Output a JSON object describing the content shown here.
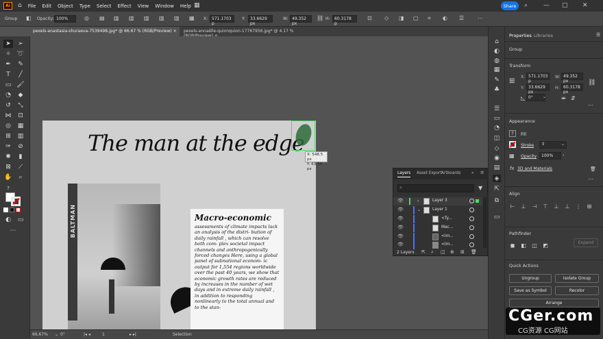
{
  "app": {
    "logo": "Ai"
  },
  "menu": [
    "File",
    "Edit",
    "Object",
    "Type",
    "Select",
    "Effect",
    "View",
    "Window",
    "Help"
  ],
  "share_label": "Share",
  "control_bar": {
    "selection": "Group",
    "opacity_label": "Opacity:",
    "opacity_value": "100%",
    "x_label": "X:",
    "x_value": "571.1703 p",
    "y_label": "Y:",
    "y_value": "33.6629 px",
    "w_label": "W:",
    "w_value": "49.352 px",
    "h_label": "H:",
    "h_value": "60.3178 p"
  },
  "tabs": [
    {
      "label": "pexels-anastasia-shuraeva-7539498.jpg* @ 66.67 % (RGB/Preview)",
      "close": "×"
    },
    {
      "label": "pexels-annaëlle-quionquion-17767956.jpg* @ 4.17 % (RGB/Preview)",
      "close": "×"
    }
  ],
  "artboard": {
    "title": "The man at the edge",
    "photo_sign": "BALTMAN",
    "text_title": "Macro-economic",
    "text_body": "assessments of climate impacts lack an analysis of the distri- bution of daily rainfall , which can resolve both com- plex societal impact channels and anthropogenically forced changes Here, using a global panel of subnational econom- ic output for 1,554 regions worldwide over the past 40 years, we show that economic growth rates are reduced by increases in the number of wet days and in extreme daily rainfall , in addition to responding nonlinearly to the total annual and to the stan-"
  },
  "coord_tip": {
    "x": "X: 548.5 px",
    "y": "Y: 63.55 px"
  },
  "status": {
    "zoom": "66.67%",
    "rotation": "0°",
    "artboard": "1",
    "tool": "Selection"
  },
  "layers_panel": {
    "tabs": [
      "Layers",
      "Asset Export",
      "Artboards"
    ],
    "rows": [
      {
        "label": "Layer 3"
      },
      {
        "label": "Layer 1"
      },
      {
        "label": "<Ty..."
      },
      {
        "label": "Mac..."
      },
      {
        "label": "<Im..."
      },
      {
        "label": "<Im..."
      }
    ],
    "count": "2 Layers"
  },
  "properties": {
    "tabs": [
      "Properties",
      "Libraries"
    ],
    "selection": "Group",
    "transform_title": "Transform",
    "x_label": "X:",
    "x": "571.1703 p",
    "y_label": "Y:",
    "y": "33.6629 px",
    "w_label": "W:",
    "w": "49.352 px",
    "h_label": "H:",
    "h": "60.3178 px",
    "angle": "0°",
    "appearance_title": "Appearance",
    "fill_label": "Fill",
    "stroke_label": "Stroke",
    "opacity_label": "Opacity",
    "opacity": "100%",
    "fx_label": "3D and Materials",
    "align_title": "Align",
    "pathfinder_title": "Pathfinder",
    "expand_label": "Expand",
    "quick_actions_title": "Quick Actions",
    "buttons": {
      "ungroup": "Ungroup",
      "isolate": "Isolate Group",
      "save_symbol": "Save as Symbol",
      "recolor": "Recolor",
      "arrange": "Arrange"
    }
  },
  "watermark": {
    "main": "CGer.com",
    "sub": "CG资源 CG网站"
  },
  "colors": {
    "accent": "#1473e6",
    "selection": "#4cd964",
    "layer_bar": "#4a73ff"
  }
}
